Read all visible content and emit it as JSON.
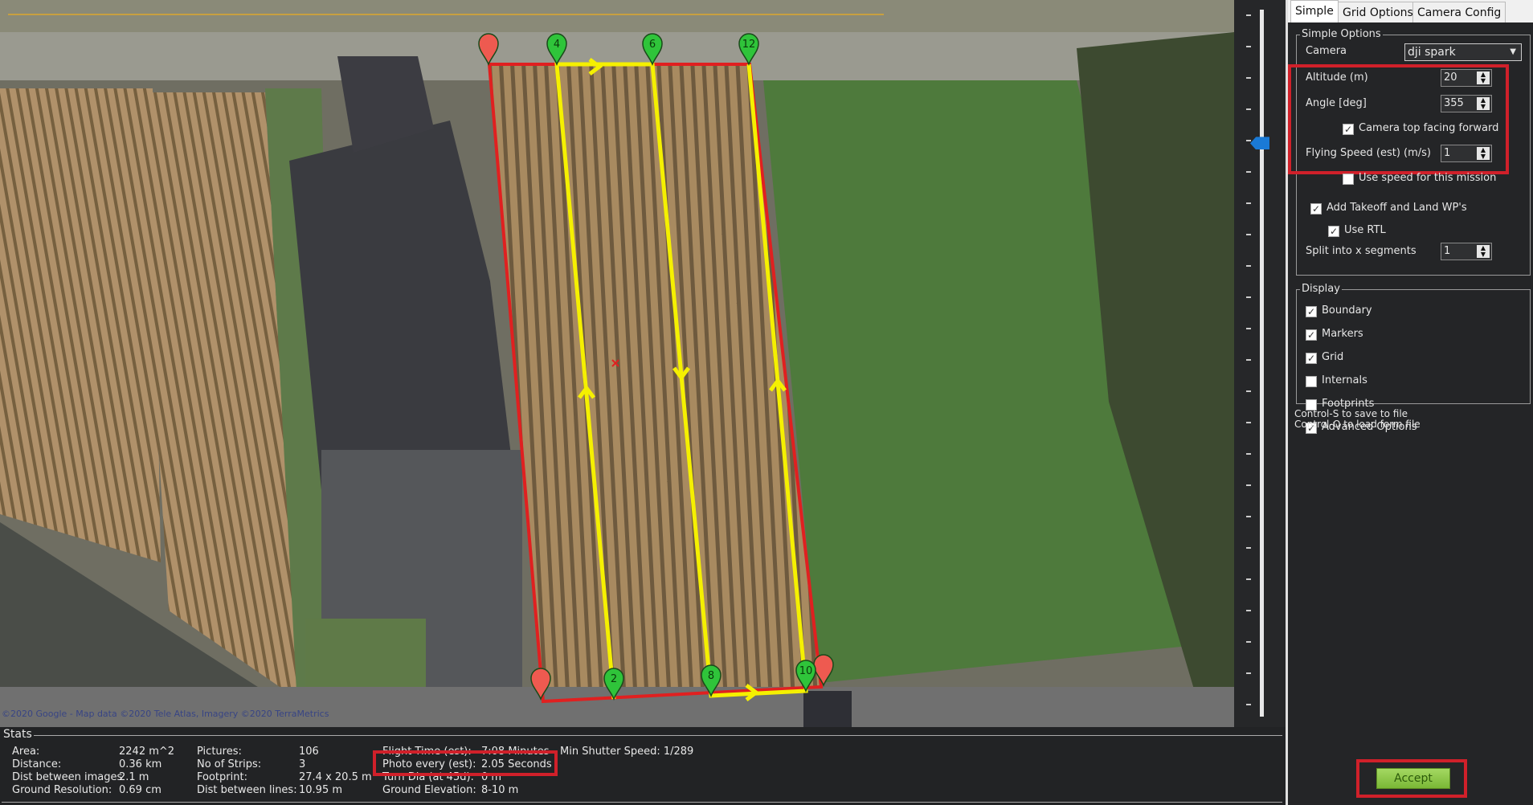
{
  "map": {
    "attribution": "©2020 Google - Map data ©2020 Tele Atlas, Imagery ©2020 TerraMetrics",
    "waypoints": [
      {
        "label": "4",
        "color": "#2fc43a"
      },
      {
        "label": "6",
        "color": "#2fc43a"
      },
      {
        "label": "12",
        "color": "#2fc43a"
      },
      {
        "label": "2",
        "color": "#2fc43a"
      },
      {
        "label": "8",
        "color": "#2fc43a"
      },
      {
        "label": "10",
        "color": "#2fc43a"
      }
    ],
    "boundary_color": "#e02020",
    "path_color": "#f5f000"
  },
  "stats": {
    "title": "Stats",
    "items": [
      {
        "label": "Area:",
        "value": "2242 m^2"
      },
      {
        "label": "Distance:",
        "value": "0.36 km"
      },
      {
        "label": "Dist between images",
        "value": "2.1 m"
      },
      {
        "label": "Ground Resolution:",
        "value": "0.69 cm"
      },
      {
        "label": "Pictures:",
        "value": "106"
      },
      {
        "label": "No of Strips:",
        "value": "3"
      },
      {
        "label": "Footprint:",
        "value": "27.4 x 20.5 m"
      },
      {
        "label": "Dist between lines:",
        "value": "10.95 m"
      },
      {
        "label": "Flight Time (est):",
        "value": "7:08 Minutes"
      },
      {
        "label": "Photo every (est):",
        "value": "2.05 Seconds"
      },
      {
        "label": "Turn Dia (at 45d):",
        "value": "0 m"
      },
      {
        "label": "Ground Elevation:",
        "value": "8-10 m"
      }
    ],
    "min_shutter": "Min Shutter Speed: 1/289"
  },
  "panel": {
    "tabs": [
      "Simple",
      "Grid Options",
      "Camera Config"
    ],
    "simple_options": {
      "title": "Simple Options",
      "camera_label": "Camera",
      "camera_value": "dji spark",
      "altitude_label": "Altitude (m)",
      "altitude_value": "20",
      "angle_label": "Angle [deg]",
      "angle_value": "355",
      "camera_top_label": "Camera top facing forward",
      "camera_top_checked": true,
      "speed_label": "Flying Speed (est) (m/s)",
      "speed_value": "1",
      "use_speed_label": "Use speed for this mission",
      "use_speed_checked": false,
      "takeoff_label": "Add Takeoff and Land WP's",
      "takeoff_checked": true,
      "rtl_label": "Use RTL",
      "rtl_checked": true,
      "split_label": "Split into x segments",
      "split_value": "1"
    },
    "display": {
      "title": "Display",
      "items": [
        {
          "label": "Boundary",
          "checked": true
        },
        {
          "label": "Markers",
          "checked": true
        },
        {
          "label": "Grid",
          "checked": true
        },
        {
          "label": "Internals",
          "checked": false
        },
        {
          "label": "Footprints",
          "checked": false
        },
        {
          "label": "Advanced Options",
          "checked": true
        }
      ]
    },
    "hint_save": "Control-S to save to file",
    "hint_load": "Control-O to load form file",
    "accept_label": "Accept"
  },
  "zoom_level_fraction": 0.82
}
